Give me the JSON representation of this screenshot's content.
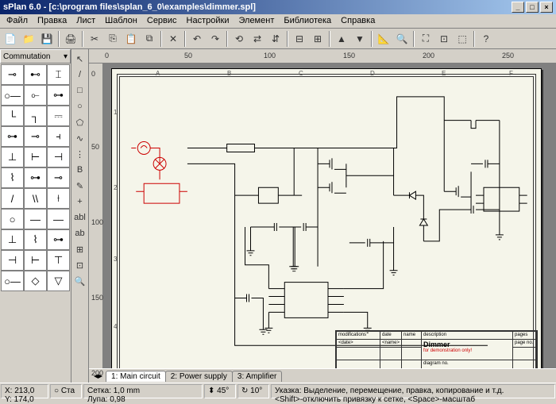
{
  "window": {
    "title": "sPlan 6.0 - [c:\\program files\\splan_6_0\\examples\\dimmer.spl]",
    "controls": {
      "min": "_",
      "max": "□",
      "close": "×"
    }
  },
  "menu": [
    "Файл",
    "Правка",
    "Лист",
    "Шаблон",
    "Сервис",
    "Настройки",
    "Элемент",
    "Библиотека",
    "Справка"
  ],
  "library": {
    "title": "Commutation",
    "symbols": [
      "⊸",
      "⊷",
      "⌶",
      "○—",
      "⟜",
      "⊶",
      "└",
      "┐",
      "⎓",
      "⊶",
      "⊸",
      "⫞",
      "⊥",
      "⊢",
      "⊣",
      "⌇",
      "⊶",
      "⊸",
      "/",
      "\\\\",
      "⟊",
      "○",
      "—",
      "—",
      "⊥",
      "⌇",
      "⊶",
      "⊣",
      "⊢",
      "⊤",
      "○—",
      "◇",
      "▽"
    ]
  },
  "tools": [
    "↖",
    "/",
    "□",
    "○",
    "⬠",
    "∿",
    "⋮",
    "B",
    "✎",
    "+",
    "abl",
    "ab",
    "⊞",
    "⊡",
    "🔍"
  ],
  "ruler": {
    "h": [
      "0",
      "50",
      "100",
      "150",
      "200",
      "250"
    ],
    "v": [
      "0",
      "50",
      "100",
      "150",
      "200"
    ],
    "cols": [
      "A",
      "B",
      "C",
      "D",
      "E",
      "F"
    ],
    "rows": [
      "1",
      "2",
      "3",
      "4"
    ]
  },
  "titleblock": {
    "h_mod": "modifications",
    "h_date": "date",
    "h_name": "name",
    "h_desc": "description",
    "h_pages": "pages",
    "date_lbl": "<date>",
    "name_lbl": "<name>",
    "proj": "Dimmer",
    "note": "for demonstration only!",
    "diag": "diagram no.",
    "pgno": "page no."
  },
  "tabs": {
    "t1": "1: Main circuit",
    "t2": "2: Power supply",
    "t3": "3: Amplifier"
  },
  "status": {
    "coord": "X: 213,0\nY: 174,0",
    "std": "○ Ста",
    "grid": "Сетка: 1,0 mm",
    "zoom": "Лупа: 0,98",
    "scale": "⬍ 45°",
    "angle": "↻ 10°",
    "hint": "Указка: Выделение, перемещение, правка, копирование и т.д.\n<Shift>-отключить привязку к сетке, <Space>-масштаб"
  }
}
